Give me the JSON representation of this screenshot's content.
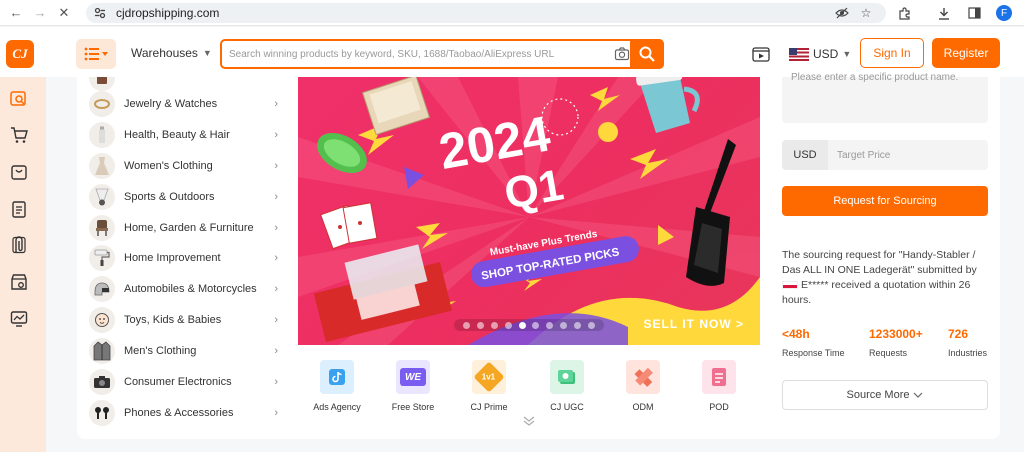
{
  "browser": {
    "url": "cjdropshipping.com",
    "avatar_letter": "F"
  },
  "header": {
    "logo_text": "CJ",
    "warehouses_label": "Warehouses",
    "search_placeholder": "Search winning products by keyword, SKU, 1688/Taobao/AliExpress URL",
    "currency": "USD",
    "signin_label": "Sign In",
    "register_label": "Register"
  },
  "categories": [
    {
      "label": "Jewelry & Watches",
      "icon": "ring-icon"
    },
    {
      "label": "Health, Beauty & Hair",
      "icon": "beauty-icon"
    },
    {
      "label": "Women's Clothing",
      "icon": "dress-icon"
    },
    {
      "label": "Sports & Outdoors",
      "icon": "shuttlecock-icon"
    },
    {
      "label": "Home, Garden & Furniture",
      "icon": "chair-icon"
    },
    {
      "label": "Home Improvement",
      "icon": "roller-icon"
    },
    {
      "label": "Automobiles & Motorcycles",
      "icon": "helmet-icon"
    },
    {
      "label": "Toys, Kids & Babies",
      "icon": "baby-icon"
    },
    {
      "label": "Men's Clothing",
      "icon": "jacket-icon"
    },
    {
      "label": "Consumer Electronics",
      "icon": "camera-icon"
    },
    {
      "label": "Phones & Accessories",
      "icon": "earbuds-icon"
    }
  ],
  "banner": {
    "year": "2024",
    "quarter": "Q1",
    "tagline": "Must-have Plus Trends",
    "pill": "SHOP TOP-RATED PICKS",
    "cta": "SELL IT NOW >",
    "slide_count": 10,
    "active_slide": 5
  },
  "services": [
    {
      "label": "Ads Agency",
      "icon": "tiktok-icon",
      "bg": "#dcefff",
      "fg": "#3aa0f0"
    },
    {
      "label": "Free Store",
      "icon": "we-icon",
      "bg": "#ebe6ff",
      "fg": "#7b5cf0",
      "badge": "WE"
    },
    {
      "label": "CJ Prime",
      "icon": "prime-badge-icon",
      "bg": "#fff0dc",
      "fg": "#f5a623",
      "badge": "1v1"
    },
    {
      "label": "CJ UGC",
      "icon": "ugc-icon",
      "bg": "#ddf5e6",
      "fg": "#3cc07a"
    },
    {
      "label": "ODM",
      "icon": "ruler-icon",
      "bg": "#ffe4de",
      "fg": "#f07058"
    },
    {
      "label": "POD",
      "icon": "document-icon",
      "bg": "#ffe3ea",
      "fg": "#f06f8f"
    }
  ],
  "sourcing": {
    "request_placeholder": "Please enter a specific product name.",
    "price_currency": "USD",
    "price_placeholder": "Target Price",
    "button": "Request for Sourcing",
    "note_before": "The sourcing request for \"Handy-Stabler / Das ALL IN ONE Ladegerät\" submitted by",
    "note_user": "E*****",
    "note_after": "received a quotation within 26 hours.",
    "stats": [
      {
        "value": "<48h",
        "label": "Response Time"
      },
      {
        "value": "1233000+",
        "label": "Requests"
      },
      {
        "value": "726",
        "label": "Industries"
      }
    ],
    "more_label": "Source More"
  },
  "colors": {
    "accent": "#ff6a00",
    "banner_pink": "#ec2f5f",
    "rail_bg": "#fde9dc"
  }
}
